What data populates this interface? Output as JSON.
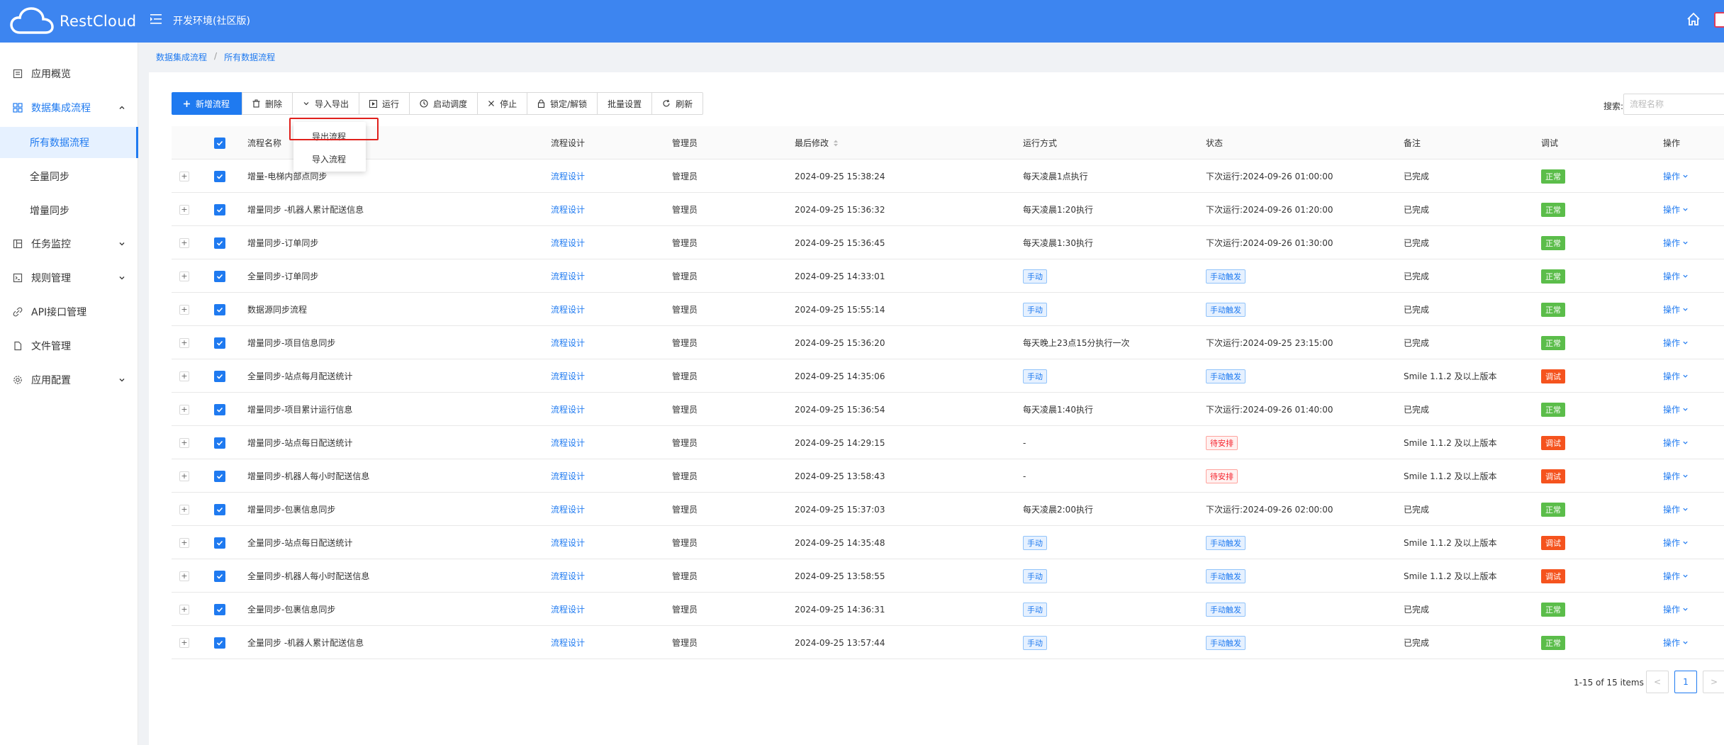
{
  "header": {
    "logo_text": "RestCloud",
    "env_title": "开发环境(社区版)"
  },
  "sidebar": {
    "items": [
      {
        "label": "应用概览",
        "icon": "overview-icon"
      },
      {
        "label": "数据集成流程",
        "icon": "grid-icon"
      },
      {
        "label": "所有数据流程"
      },
      {
        "label": "全量同步"
      },
      {
        "label": "增量同步"
      },
      {
        "label": "任务监控",
        "icon": "monitor-icon"
      },
      {
        "label": "规则管理",
        "icon": "rules-icon"
      },
      {
        "label": "API接口管理",
        "icon": "api-icon"
      },
      {
        "label": "文件管理",
        "icon": "file-icon"
      },
      {
        "label": "应用配置",
        "icon": "settings-icon"
      }
    ]
  },
  "breadcrumb": {
    "items": [
      "数据集成流程",
      "所有数据流程"
    ],
    "separator": "/"
  },
  "toolbar": {
    "new_label": "新增流程",
    "delete_label": "删除",
    "import_export_label": "导入导出",
    "run_label": "运行",
    "schedule_label": "启动调度",
    "stop_label": "停止",
    "lock_label": "锁定/解锁",
    "batch_label": "批量设置",
    "refresh_label": "刷新"
  },
  "dropdown": {
    "items": [
      "导出流程",
      "导入流程"
    ]
  },
  "search": {
    "label": "搜索:",
    "placeholder": "流程名称"
  },
  "table": {
    "columns": [
      "流程名称",
      "流程设计",
      "管理员",
      "最后修改",
      "运行方式",
      "状态",
      "备注",
      "调试",
      "操作"
    ],
    "rows": [
      {
        "name": "增量-电梯内部点同步",
        "design": "流程设计",
        "admin": "管理员",
        "modified": "2024-09-25 15:38:24",
        "run_mode": "每天凌晨1点执行",
        "run_tag": false,
        "status": "下次运行:2024-09-26 01:00:00",
        "status_tag": "",
        "remark": "已完成",
        "debug": "正常",
        "debug_color": "green",
        "op": "操作"
      },
      {
        "name": "增量同步 -机器人累计配送信息",
        "design": "流程设计",
        "admin": "管理员",
        "modified": "2024-09-25 15:36:32",
        "run_mode": "每天凌晨1:20执行",
        "run_tag": false,
        "status": "下次运行:2024-09-26 01:20:00",
        "status_tag": "",
        "remark": "已完成",
        "debug": "正常",
        "debug_color": "green",
        "op": "操作"
      },
      {
        "name": "增量同步-订单同步",
        "design": "流程设计",
        "admin": "管理员",
        "modified": "2024-09-25 15:36:45",
        "run_mode": "每天凌晨1:30执行",
        "run_tag": false,
        "status": "下次运行:2024-09-26 01:30:00",
        "status_tag": "",
        "remark": "已完成",
        "debug": "正常",
        "debug_color": "green",
        "op": "操作"
      },
      {
        "name": "全量同步-订单同步",
        "design": "流程设计",
        "admin": "管理员",
        "modified": "2024-09-25 14:33:01",
        "run_mode": "手动",
        "run_tag": true,
        "status": "手动触发",
        "status_tag": "blue",
        "remark": "已完成",
        "debug": "正常",
        "debug_color": "green",
        "op": "操作"
      },
      {
        "name": "数据源同步流程",
        "design": "流程设计",
        "admin": "管理员",
        "modified": "2024-09-25 15:55:14",
        "run_mode": "手动",
        "run_tag": true,
        "status": "手动触发",
        "status_tag": "blue",
        "remark": "已完成",
        "debug": "正常",
        "debug_color": "green",
        "op": "操作"
      },
      {
        "name": "增量同步-项目信息同步",
        "design": "流程设计",
        "admin": "管理员",
        "modified": "2024-09-25 15:36:20",
        "run_mode": "每天晚上23点15分执行一次",
        "run_tag": false,
        "status": "下次运行:2024-09-25 23:15:00",
        "status_tag": "",
        "remark": "已完成",
        "debug": "正常",
        "debug_color": "green",
        "op": "操作"
      },
      {
        "name": "全量同步-站点每月配送统计",
        "design": "流程设计",
        "admin": "管理员",
        "modified": "2024-09-25 14:35:06",
        "run_mode": "手动",
        "run_tag": true,
        "status": "手动触发",
        "status_tag": "blue",
        "remark": "Smile 1.1.2 及以上版本",
        "debug": "调试",
        "debug_color": "orange",
        "op": "操作"
      },
      {
        "name": "增量同步-项目累计运行信息",
        "design": "流程设计",
        "admin": "管理员",
        "modified": "2024-09-25 15:36:54",
        "run_mode": "每天凌晨1:40执行",
        "run_tag": false,
        "status": "下次运行:2024-09-26 01:40:00",
        "status_tag": "",
        "remark": "已完成",
        "debug": "正常",
        "debug_color": "green",
        "op": "操作"
      },
      {
        "name": "增量同步-站点每日配送统计",
        "design": "流程设计",
        "admin": "管理员",
        "modified": "2024-09-25 14:29:15",
        "run_mode": "-",
        "run_tag": false,
        "status": "待安排",
        "status_tag": "red",
        "remark": "Smile 1.1.2 及以上版本",
        "debug": "调试",
        "debug_color": "orange",
        "op": "操作"
      },
      {
        "name": "增量同步-机器人每小时配送信息",
        "design": "流程设计",
        "admin": "管理员",
        "modified": "2024-09-25 13:58:43",
        "run_mode": "-",
        "run_tag": false,
        "status": "待安排",
        "status_tag": "red",
        "remark": "Smile 1.1.2 及以上版本",
        "debug": "调试",
        "debug_color": "orange",
        "op": "操作"
      },
      {
        "name": "增量同步-包裹信息同步",
        "design": "流程设计",
        "admin": "管理员",
        "modified": "2024-09-25 15:37:03",
        "run_mode": "每天凌晨2:00执行",
        "run_tag": false,
        "status": "下次运行:2024-09-26 02:00:00",
        "status_tag": "",
        "remark": "已完成",
        "debug": "正常",
        "debug_color": "green",
        "op": "操作"
      },
      {
        "name": "全量同步-站点每日配送统计",
        "design": "流程设计",
        "admin": "管理员",
        "modified": "2024-09-25 14:35:48",
        "run_mode": "手动",
        "run_tag": true,
        "status": "手动触发",
        "status_tag": "blue",
        "remark": "Smile 1.1.2 及以上版本",
        "debug": "调试",
        "debug_color": "orange",
        "op": "操作"
      },
      {
        "name": "全量同步-机器人每小时配送信息",
        "design": "流程设计",
        "admin": "管理员",
        "modified": "2024-09-25 13:58:55",
        "run_mode": "手动",
        "run_tag": true,
        "status": "手动触发",
        "status_tag": "blue",
        "remark": "Smile 1.1.2 及以上版本",
        "debug": "调试",
        "debug_color": "orange",
        "op": "操作"
      },
      {
        "name": "全量同步-包裹信息同步",
        "design": "流程设计",
        "admin": "管理员",
        "modified": "2024-09-25 14:36:31",
        "run_mode": "手动",
        "run_tag": true,
        "status": "手动触发",
        "status_tag": "blue",
        "remark": "已完成",
        "debug": "正常",
        "debug_color": "green",
        "op": "操作"
      },
      {
        "name": "全量同步 -机器人累计配送信息",
        "design": "流程设计",
        "admin": "管理员",
        "modified": "2024-09-25 13:57:44",
        "run_mode": "手动",
        "run_tag": true,
        "status": "手动触发",
        "status_tag": "blue",
        "remark": "已完成",
        "debug": "正常",
        "debug_color": "green",
        "op": "操作"
      }
    ]
  },
  "pagination": {
    "total_text": "1-15 of 15 items",
    "current_page": "1",
    "prev": "<",
    "next": ">"
  },
  "colors": {
    "header_bg": "#3d85f0",
    "accent": "#1f7af0",
    "success": "#5bbd4a",
    "warning": "#f5531e",
    "highlight_border": "#e0201c"
  }
}
